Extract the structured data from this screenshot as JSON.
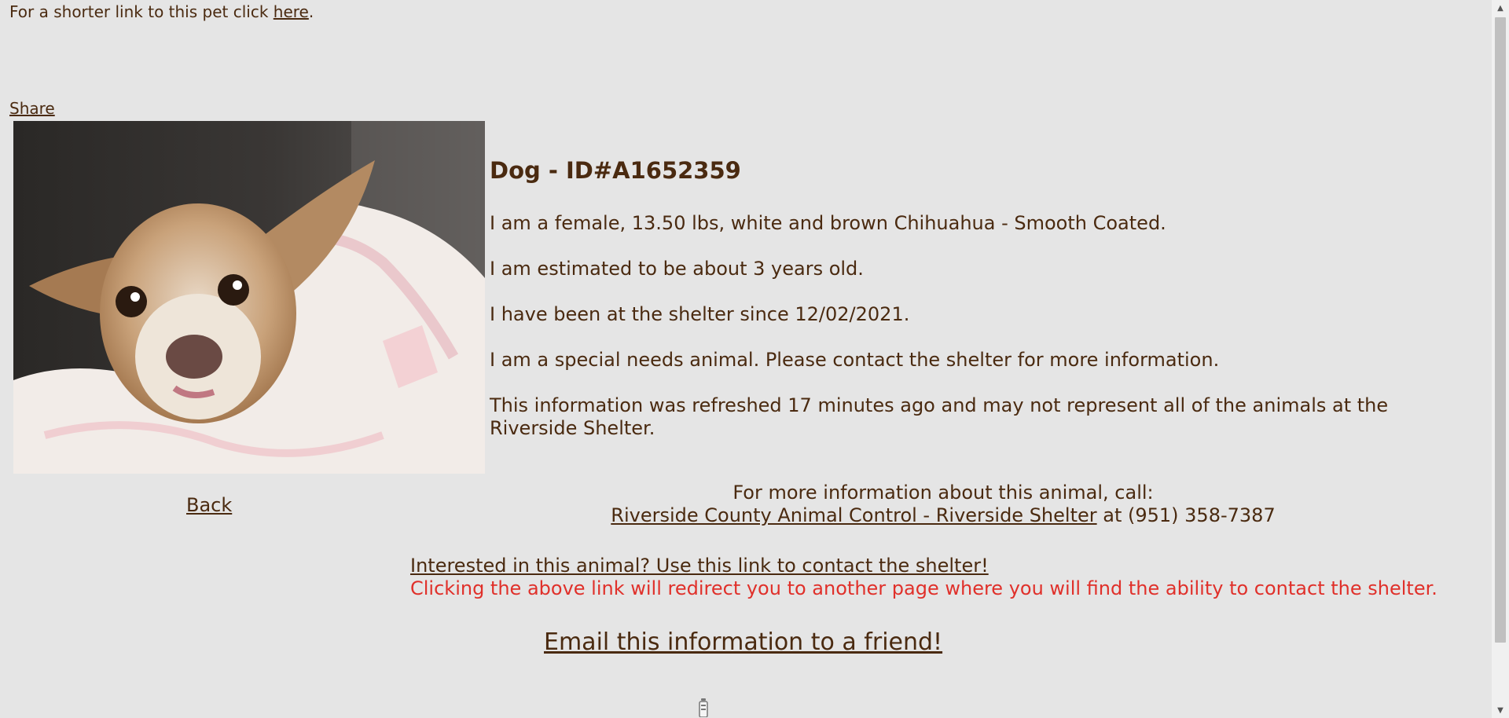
{
  "top": {
    "shorter_prefix": "For a shorter link to this pet click ",
    "shorter_link": "here",
    "shorter_suffix": ".",
    "share": "Share"
  },
  "photo": {
    "icon": "pet-photo"
  },
  "info": {
    "title": "Dog - ID#A1652359",
    "description": "I am a female, 13.50 lbs, white and brown Chihuahua - Smooth Coated.",
    "age": "I am estimated to be about 3 years old.",
    "since": "I have been at the shelter since 12/02/2021.",
    "special": "I am a special needs animal. Please contact the shelter for more information.",
    "refresh": "This information was refreshed 17 minutes ago and may not represent all of the animals at the Riverside Shelter."
  },
  "nav": {
    "back": "Back"
  },
  "contact": {
    "intro": "For more information about this animal, call:",
    "shelter_link": "Riverside County Animal Control - Riverside Shelter",
    "phone": " at (951) 358-7387"
  },
  "interest": {
    "link": "Interested in this animal? Use this link to contact the shelter!",
    "warning": "Clicking the above link will redirect you to another page where you will find the ability to contact the shelter."
  },
  "email": {
    "link": "Email this information to a friend!"
  },
  "colors": {
    "text": "#4a2a10",
    "warning": "#e0302a",
    "background": "#e5e5e5"
  }
}
